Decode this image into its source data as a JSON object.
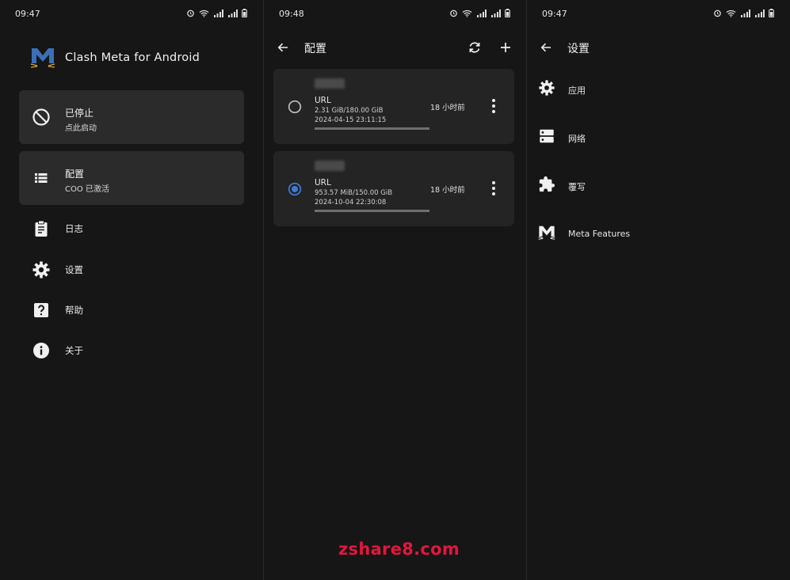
{
  "screens": {
    "home": {
      "time": "09:47",
      "app_title": "Clash Meta for Android",
      "status_card": {
        "title": "已停止",
        "subtitle": "点此启动",
        "icon": "block-icon"
      },
      "profile_card": {
        "title": "配置",
        "subtitle": "COO 已激活",
        "icon": "list-icon"
      },
      "menu": [
        {
          "label": "日志",
          "icon": "clipboard-icon"
        },
        {
          "label": "设置",
          "icon": "gear-icon"
        },
        {
          "label": "帮助",
          "icon": "help-icon"
        },
        {
          "label": "关于",
          "icon": "info-icon"
        }
      ]
    },
    "profiles": {
      "time": "09:48",
      "title": "配置",
      "items": [
        {
          "type": "URL",
          "usage": "2.31 GiB/180.00 GiB",
          "expiry": "2024-04-15 23:11:15",
          "updated": "18 小时前",
          "selected": false,
          "usage_fraction": 0.013
        },
        {
          "type": "URL",
          "usage": "953.57 MiB/150.00 GiB",
          "expiry": "2024-10-04 22:30:08",
          "updated": "18 小时前",
          "selected": true,
          "usage_fraction": 0.006
        }
      ]
    },
    "settings": {
      "time": "09:47",
      "title": "设置",
      "items": [
        {
          "label": "应用",
          "icon": "gear-icon"
        },
        {
          "label": "网络",
          "icon": "dns-icon"
        },
        {
          "label": "覆写",
          "icon": "extension-icon"
        },
        {
          "label": "Meta Features",
          "icon": "meta-logo-icon"
        }
      ]
    }
  },
  "watermark": "zshare8.com",
  "colors": {
    "background": "#161616",
    "card": "#2b2b2b",
    "accent": "#3e7bd6",
    "watermark": "#e3163c",
    "logo_blue": "#3b6fb6"
  }
}
